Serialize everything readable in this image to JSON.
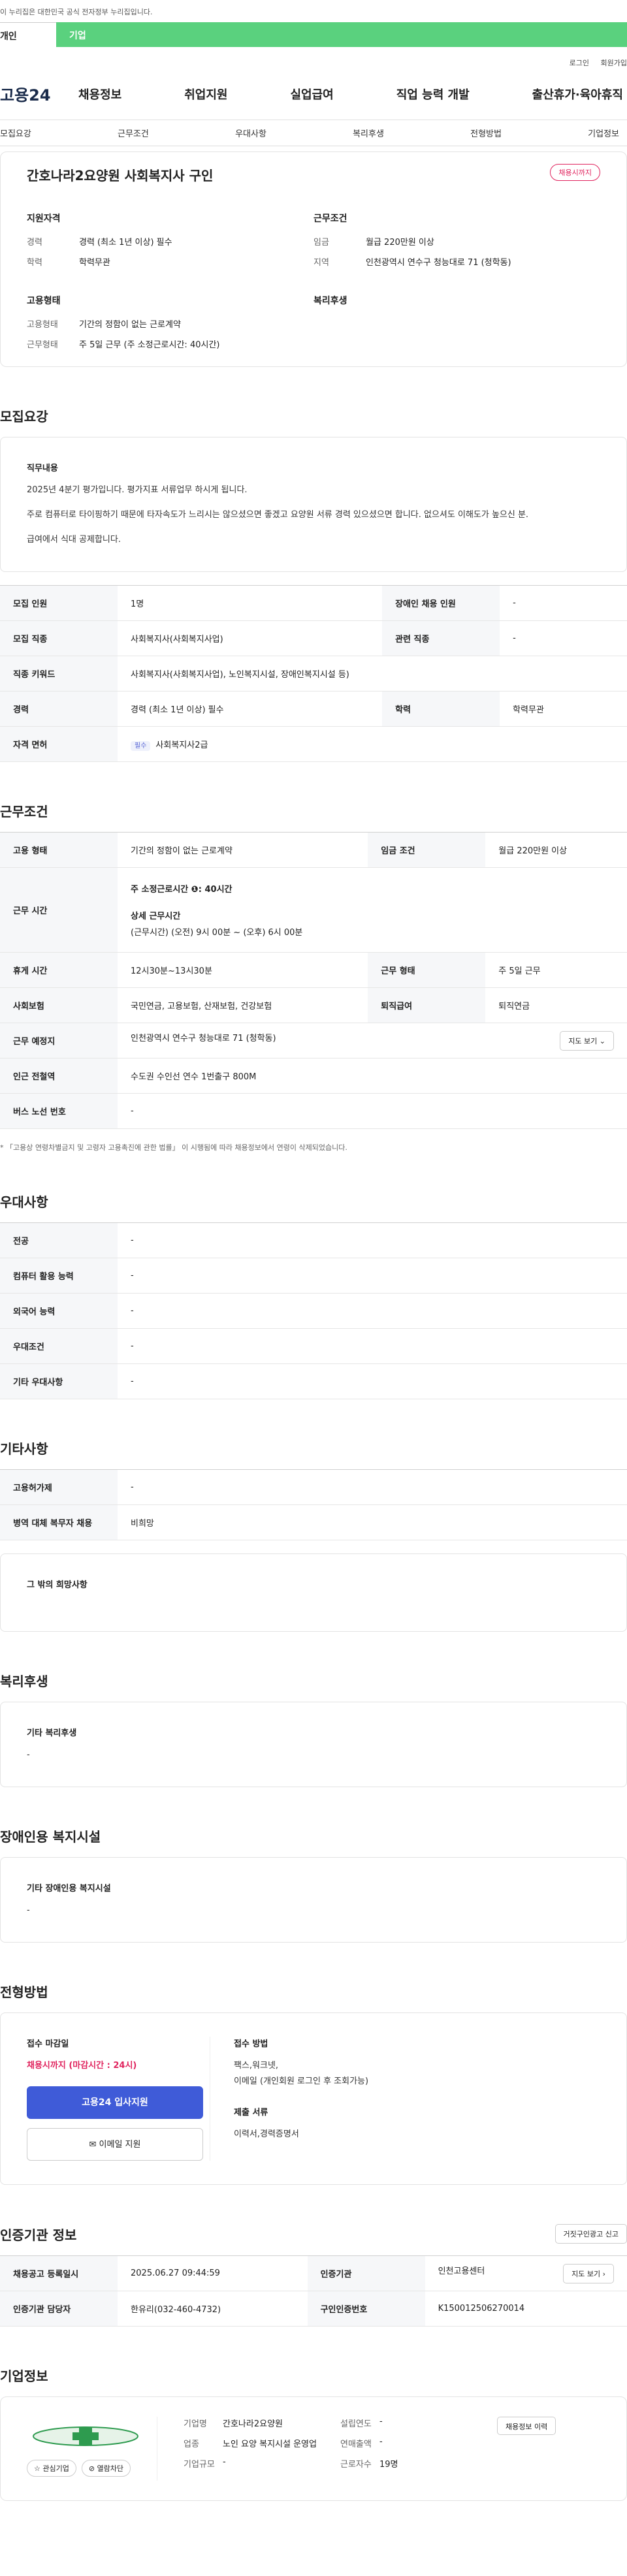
{
  "gov_banner": "이 누리집은 대한민국 공식 전자정부 누리집입니다.",
  "user_tabs": [
    "개인",
    "기업"
  ],
  "util_links": [
    "로그인",
    "회원가입"
  ],
  "logo_text": "고용24",
  "gnb": [
    "채용정보",
    "취업지원",
    "실업급여",
    "직업 능력 개발",
    "출산휴가·육아휴직"
  ],
  "anchors": [
    "모집요강",
    "근무조건",
    "우대사항",
    "복리후생",
    "전형방법",
    "기업정보"
  ],
  "summary": {
    "title": "간호나라2요양원 사회복지사 구인",
    "status_badge": "채용시까지",
    "qualification_title": "지원자격",
    "career_label": "경력",
    "career_value": "경력 (최소 1년 이상) 필수",
    "edu_label": "학력",
    "edu_value": "학력무관",
    "cond_title": "근무조건",
    "wage_label": "임금",
    "wage_value": "월급 220만원 이상",
    "region_label": "지역",
    "region_value": "인천광역시 연수구 청능대로 71 (청학동)",
    "emp_title": "고용형태",
    "emp_type_label": "고용형태",
    "emp_type_value": "기간의 정함이 없는 근로계약",
    "work_form_label": "근무형태",
    "work_form_value": "주 5일 근무 (주 소정근로시간: 40시간)",
    "welfare_title": "복리후생"
  },
  "recruit": {
    "title": "모집요강",
    "job_title": "직무내용",
    "job_lines": [
      "2025년 4분기 평가입니다. 평가지표 서류업무 하시게 됩니다.",
      "주로 컴퓨터로 타이핑하기 때문에 타자속도가 느리시는 않으셨으면 좋겠고 요양원 서류 경력 있으셨으면 합니다. 없으셔도 이해도가 높으신 분.",
      "급여에서 식대 공제합니다."
    ],
    "rows": [
      [
        "모집 인원",
        "1명",
        "장애인 채용 인원",
        "-"
      ],
      [
        "모집 직종",
        "사회복지사(사회복지사업)",
        "관련 직종",
        "-"
      ],
      [
        "직종 키워드",
        "사회복지사(사회복지사업), 노인복지시설, 장애인복지시설 등)"
      ],
      [
        "경력",
        "경력 (최소 1년 이상) 필수",
        "학력",
        "학력무관"
      ],
      [
        "자격 면허",
        "사회복지사2급"
      ]
    ],
    "license_pill": "필수"
  },
  "conditions": {
    "title": "근무조건",
    "emp_label": "고용 형태",
    "emp_value": "기간의 정함이 없는 근로계약",
    "wage_label": "임금 조건",
    "wage_value": "월급 220만원 이상",
    "hours_label": "근무 시간",
    "hours_week": "주 소정근로시간 ❶: 40시간",
    "hours_detail_title": "상세 근무시간",
    "hours_detail": "(근무시간) (오전) 9시 00분 ~ (오후) 6시 00분",
    "rest_label": "휴게 시간",
    "rest_value": "12시30분~13시30분",
    "work_label": "근무 형태",
    "work_value": "주 5일 근무",
    "ins_label": "사회보험",
    "ins_value": "국민연금, 고용보험, 산재보험, 건강보험",
    "ret_label": "퇴직급여",
    "ret_value": "퇴직연금",
    "place_label": "근무 예정지",
    "place_value": "인천광역시 연수구 청능대로 71 (청학동)",
    "map_btn": "지도 보기 ⌄",
    "subway_label": "인근 전철역",
    "subway_value": "수도권 수인선 연수 1번출구 800M",
    "bus_label": "버스 노선 번호",
    "bus_value": "-",
    "note": "* 「고용상 연령차별금지 및 고령자 고용촉진에 관한 법률」 이 시행됨에 따라 채용정보에서 연령이 삭제되었습니다."
  },
  "prefer": {
    "title": "우대사항",
    "rows": [
      [
        "전공",
        "-"
      ],
      [
        "컴퓨터 활용 능력",
        "-"
      ],
      [
        "외국어 능력",
        "-"
      ],
      [
        "우대조건",
        "-"
      ],
      [
        "기타 우대사항",
        "-"
      ]
    ]
  },
  "etc": {
    "title": "기타사항",
    "rows": [
      [
        "고용허가제",
        "-"
      ],
      [
        "병역 대체 복무자 채용",
        "비희망"
      ]
    ],
    "other_title": "그 밖의 희망사항"
  },
  "welfare": {
    "title": "복리후생",
    "sub": "기타 복리후생",
    "val": "-"
  },
  "disabled": {
    "title": "장애인용 복지시설",
    "sub": "기타 장애인용 복지시설",
    "val": "-"
  },
  "process": {
    "title": "전형방법",
    "deadline_title": "접수 마감일",
    "deadline_value": "채용시까지 (마감시간 : 24시)",
    "apply_btn": "고용24 입사지원",
    "email_btn": "✉ 이메일 지원",
    "method_title": "접수 방법",
    "method_value": "팩스,워크넷,",
    "method_value2": "이메일 (개인회원 로그인 후 조회가능)",
    "docs_title": "제출 서류",
    "docs_value": "이력서,경력증명서"
  },
  "agency": {
    "title": "인증기관 정보",
    "report_btn": "거짓구인광고 신고",
    "reg_label": "채용공고 등록일시",
    "reg_value": "2025.06.27 09:44:59",
    "auth_label": "인증기관",
    "auth_value": "인천고용센터",
    "map_btn": "지도 보기 ›",
    "mgr_label": "인증기관 담당자",
    "mgr_value": "한유리(032-460-4732)",
    "num_label": "구인인증번호",
    "num_value": "K150012506270014"
  },
  "company": {
    "title": "기업정보",
    "history_btn": "채용정보 이력",
    "fav": "☆ 관심기업",
    "block": "⊘ 열람차단",
    "name_label": "기업명",
    "name_value": "간호나라2요양원",
    "biz_label": "업종",
    "biz_value": "노인 요양 복지시설 운영업",
    "size_label": "기업규모",
    "size_value": "-",
    "est_label": "설립연도",
    "est_value": "-",
    "sales_label": "연매출액",
    "sales_value": "-",
    "emp_label": "근로자수",
    "emp_value": "19명"
  }
}
